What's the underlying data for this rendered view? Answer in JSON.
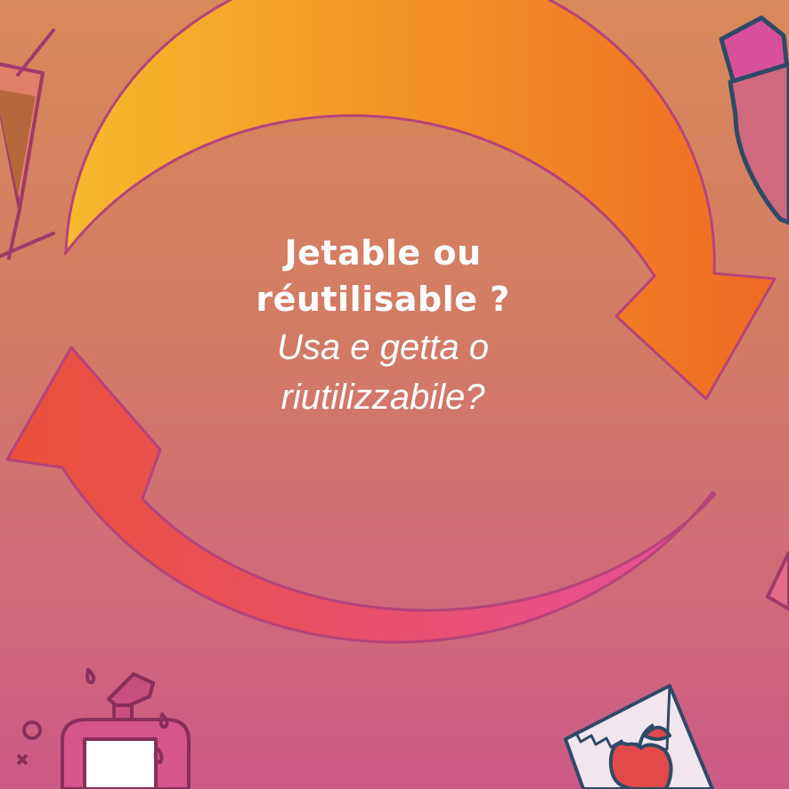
{
  "heading": {
    "line1": "Jetable ou",
    "line2": "réutilisable ?",
    "line3": "Usa e getta o",
    "line4": "riutilizzabile?"
  },
  "colors": {
    "arrow_top_start": "#f6b92c",
    "arrow_top_end": "#ee6a22",
    "arrow_bottom_start": "#e9513a",
    "arrow_bottom_end": "#e8509a",
    "outline": "#b5447d",
    "icon_stroke": "#a03a6a"
  },
  "icons": [
    "cocktail-glass-icon",
    "bottle-icon",
    "soap-dispenser-icon",
    "apple-snack-bag-icon"
  ]
}
